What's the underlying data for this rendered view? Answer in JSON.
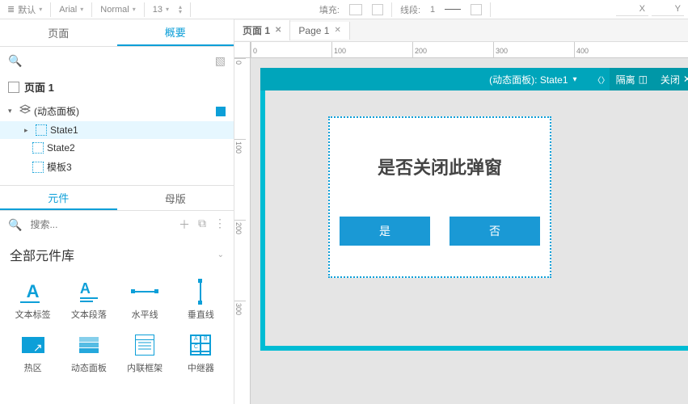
{
  "toolbar": {
    "default_label": "默认",
    "font": "Arial",
    "weight": "Normal",
    "size": "13",
    "fill_label": "填充:",
    "line_label": "线段:",
    "line_width": "1",
    "x_label": "X",
    "y_label": "Y"
  },
  "left_tabs": {
    "pages": "页面",
    "outline": "概要"
  },
  "page_title": "页面 1",
  "tree": {
    "panel": "(动态面板)",
    "state1": "State1",
    "state2": "State2",
    "template3": "模板3"
  },
  "section_tabs": {
    "widgets": "元件",
    "masters": "母版"
  },
  "widget_search": {
    "placeholder": "搜索..."
  },
  "library_title": "全部元件库",
  "widgets": [
    {
      "id": "text-label",
      "label": "文本标签"
    },
    {
      "id": "text-paragraph",
      "label": "文本段落"
    },
    {
      "id": "hline",
      "label": "水平线"
    },
    {
      "id": "vline",
      "label": "垂直线"
    },
    {
      "id": "hotspot",
      "label": "热区"
    },
    {
      "id": "dynamic-panel",
      "label": "动态面板"
    },
    {
      "id": "inline-frame",
      "label": "内联框架"
    },
    {
      "id": "repeater",
      "label": "中继器"
    }
  ],
  "canvas_tabs": [
    {
      "label": "页面 1"
    },
    {
      "label": "Page 1"
    }
  ],
  "hruler": [
    "0",
    "100",
    "200",
    "300",
    "400"
  ],
  "vruler": [
    "0",
    "100",
    "200",
    "300"
  ],
  "panel_header": {
    "title_prefix": "(动态面板):",
    "state": "State1",
    "isolate": "隔离",
    "close": "关闭"
  },
  "dialog": {
    "title": "是否关闭此弹窗",
    "yes": "是",
    "no": "否"
  }
}
